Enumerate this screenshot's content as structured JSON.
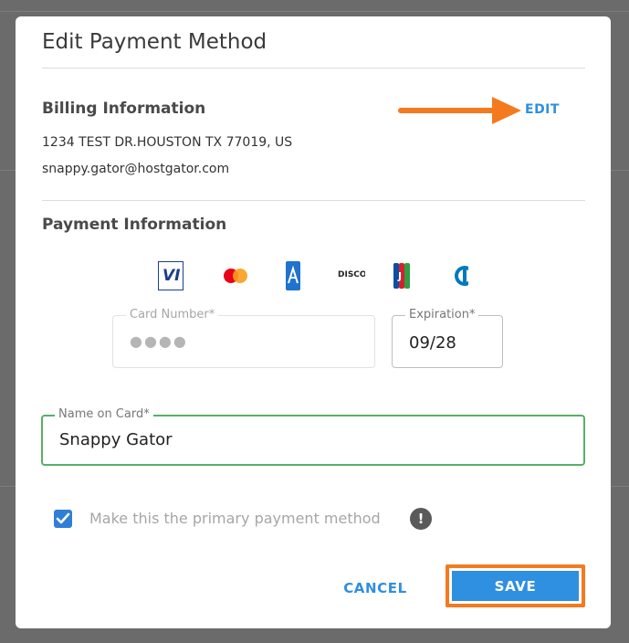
{
  "dialog": {
    "title": "Edit Payment Method"
  },
  "billing": {
    "heading": "Billing Information",
    "edit_label": "EDIT",
    "address": "1234 TEST DR.HOUSTON TX 77019, US",
    "email": "snappy.gator@hostgator.com"
  },
  "payment": {
    "heading": "Payment Information",
    "card_brands": [
      "visa-icon",
      "mastercard-icon",
      "amex-icon",
      "discover-icon",
      "jcb-icon",
      "diners-icon"
    ],
    "visa_text": "VI",
    "discover_text": "DISCO",
    "card_number": {
      "label": "Card Number*",
      "value": "●●●●"
    },
    "expiration": {
      "label": "Expiration*",
      "value": "09/28"
    },
    "name_on_card": {
      "label": "Name on Card*",
      "value": "Snappy Gator"
    },
    "primary_checkbox": {
      "label": "Make this the primary payment method",
      "checked": true
    },
    "info_symbol": "!"
  },
  "actions": {
    "cancel_label": "CANCEL",
    "save_label": "SAVE"
  },
  "colors": {
    "accent": "#2f8fe0",
    "highlight": "#f47a20",
    "field_active_border": "#5aae68"
  }
}
